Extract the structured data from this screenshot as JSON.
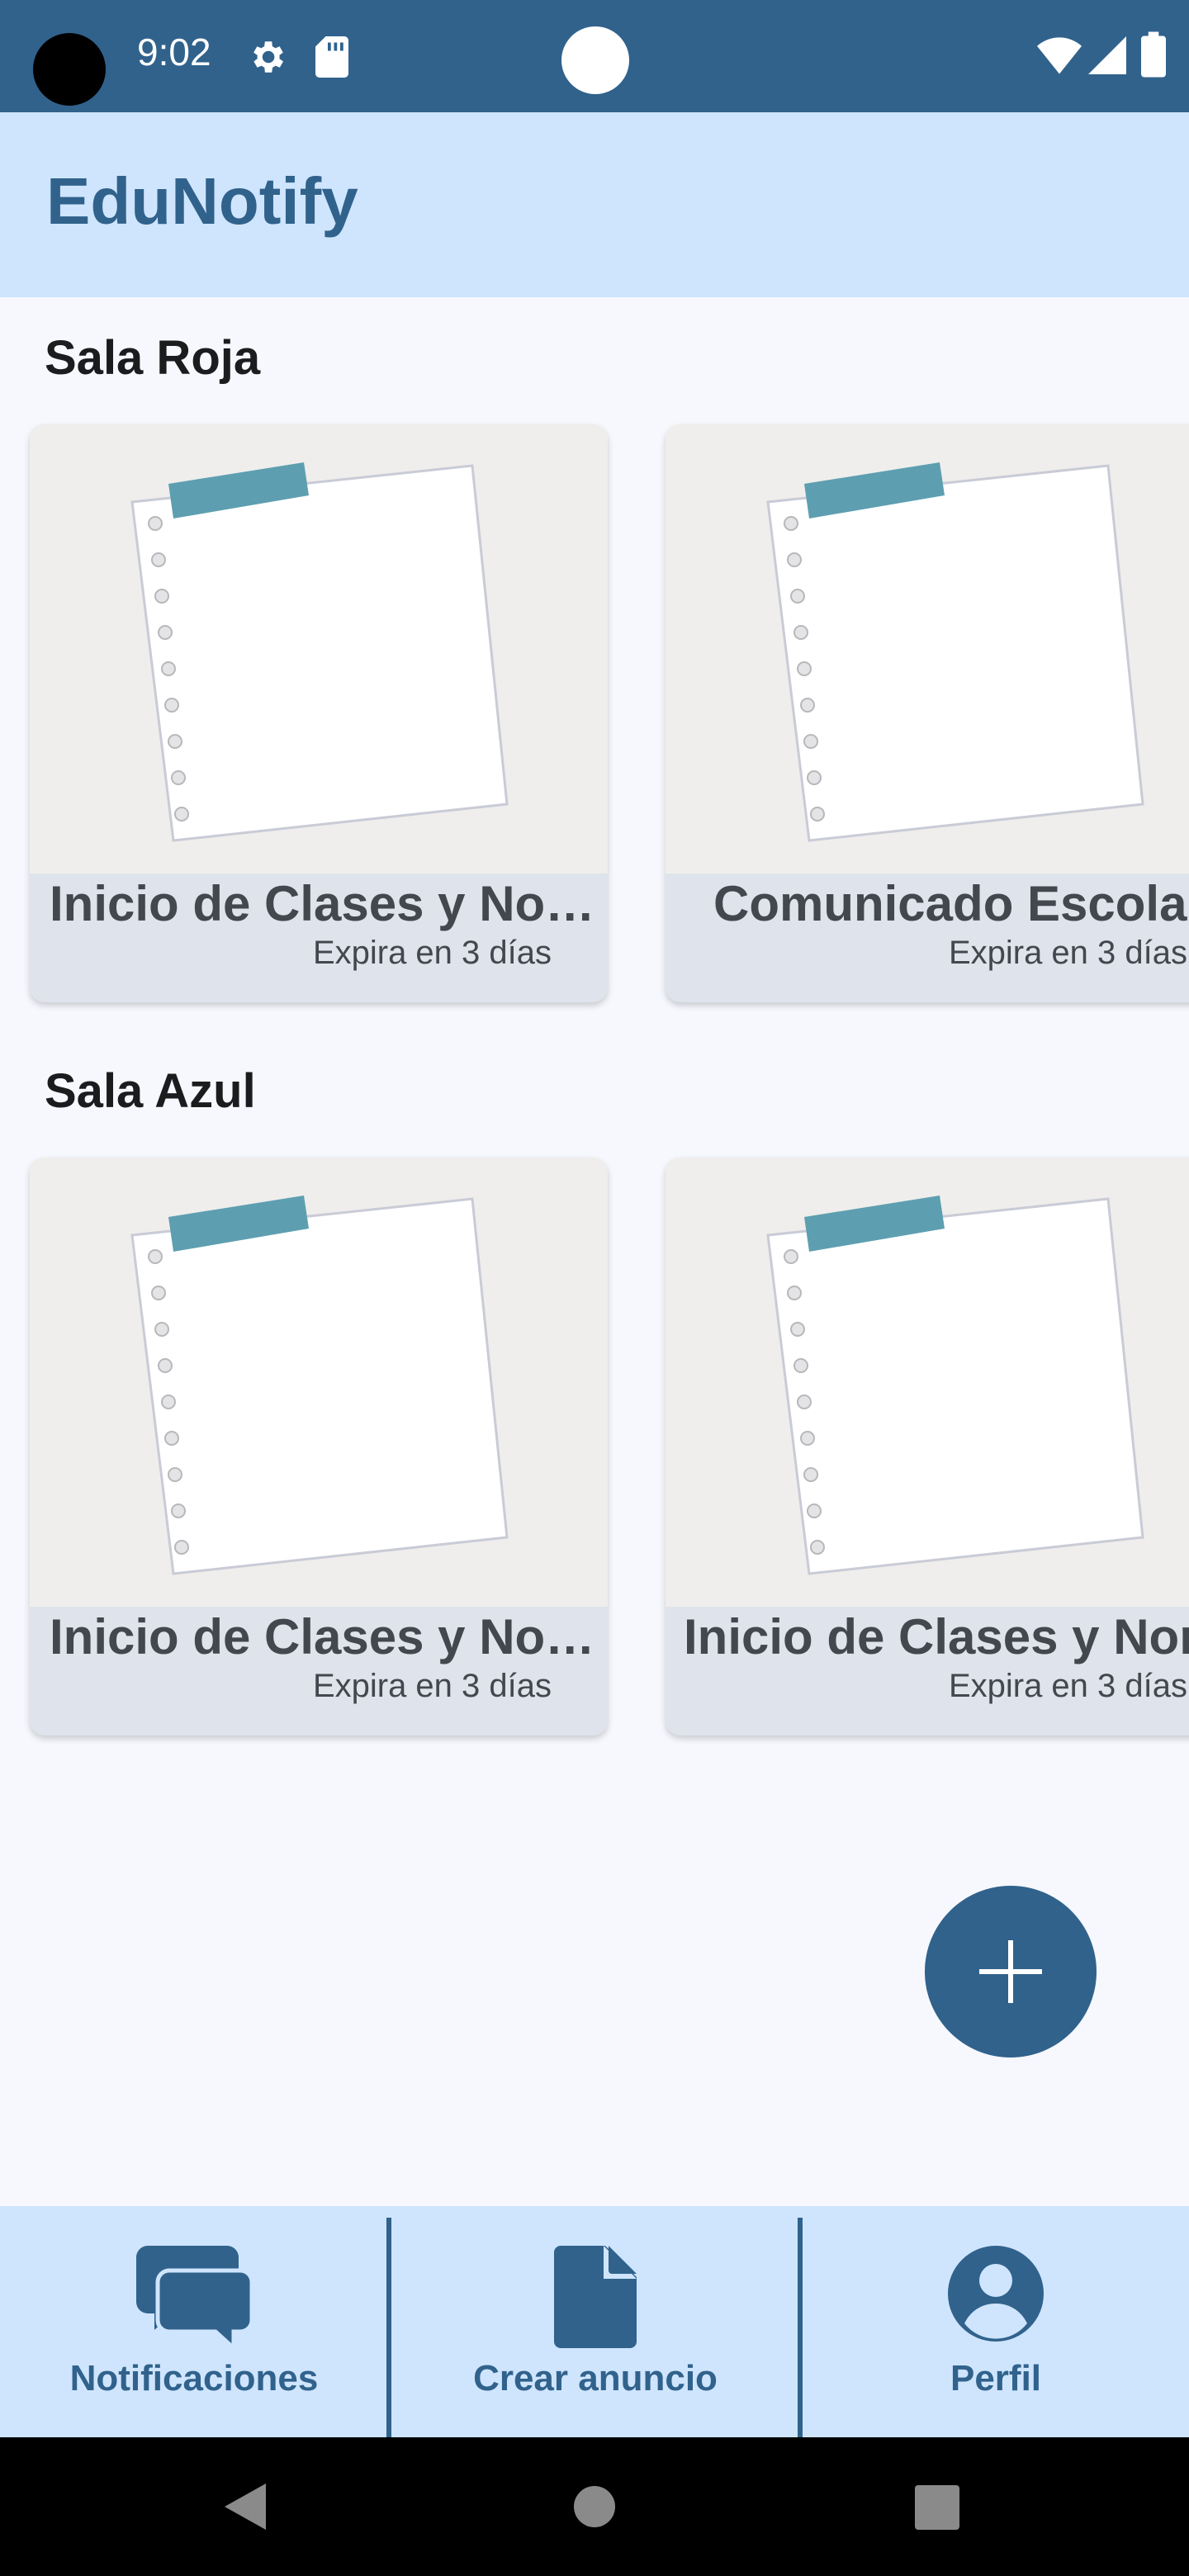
{
  "status_bar": {
    "time": "9:02",
    "icons": [
      "settings-icon",
      "sd-card-icon",
      "wifi-icon",
      "signal-icon",
      "battery-icon"
    ]
  },
  "app_bar": {
    "title": "EduNotify"
  },
  "sections": [
    {
      "title": "Sala Roja",
      "cards": [
        {
          "title": "Inicio de Clases y Nor…",
          "expiry": "Expira en 3 días"
        },
        {
          "title": "Comunicado Escolar",
          "expiry": "Expira en 3 días"
        }
      ]
    },
    {
      "title": "Sala Azul",
      "cards": [
        {
          "title": "Inicio de Clases y Nor…",
          "expiry": "Expira en 3 días"
        },
        {
          "title": "Inicio de Clases y Nor",
          "expiry": "Expira en 3 días"
        }
      ]
    }
  ],
  "fab": {
    "icon": "plus-icon"
  },
  "bottom_nav": [
    {
      "label": "Notificaciones",
      "icon": "chat-bubbles-icon"
    },
    {
      "label": "Crear anuncio",
      "icon": "document-icon"
    },
    {
      "label": "Perfil",
      "icon": "account-circle-icon"
    }
  ],
  "colors": {
    "primary": "#30628c",
    "app_bar_bg": "#cfe5fd",
    "background": "#f6f8fd",
    "card_footer": "#dfe3eb",
    "tape": "#5d9fb0"
  }
}
